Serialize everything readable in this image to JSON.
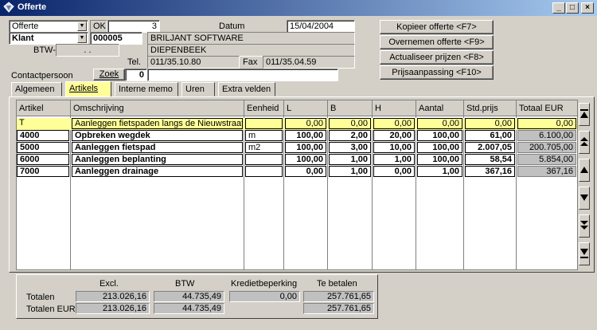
{
  "window": {
    "title": "Offerte"
  },
  "header": {
    "doc_type": "Offerte",
    "ok_label": "OK",
    "doc_number": "3",
    "date_label": "Datum",
    "date_value": "15/04/2004",
    "customer_type": "Klant",
    "customer_number": "000005",
    "customer_name": "BRILJANT SOFTWARE",
    "customer_city": "DIEPENBEEK",
    "vat_label": "BTW-nr",
    "vat_value": ".   .",
    "tel_label": "Tel.",
    "tel_value": "011/35.10.80",
    "fax_label": "Fax",
    "fax_value": "011/35.04.59",
    "contact_label": "Contactpersoon",
    "zoek_label": "Zoek",
    "contact_num": "0",
    "contact_name": ""
  },
  "actions": {
    "copy": "Kopieer offerte <F7>",
    "take_over": "Overnemen offerte <F9>",
    "update_prices": "Actualiseer prijzen <F8>",
    "adjust_prices": "Prijsaanpassing <F10>"
  },
  "tabs": [
    "Algemeen",
    "Artikels",
    "Interne memo",
    "Uren",
    "Extra velden"
  ],
  "table": {
    "columns": [
      "Artikel",
      "Omschrijving",
      "Eenheid",
      "L",
      "B",
      "H",
      "Aantal",
      "Std.prijs",
      "Totaal EUR"
    ],
    "rows": [
      [
        "T",
        "Aanleggen fietspaden langs de Nieuwstraat",
        "",
        "0,00",
        "0,00",
        "0,00",
        "0,00",
        "0,00",
        "0,00"
      ],
      [
        "4000",
        "Opbreken wegdek",
        "m",
        "100,00",
        "2,00",
        "20,00",
        "100,00",
        "61,00",
        "6.100,00"
      ],
      [
        "5000",
        "Aanleggen fietspad",
        "m2",
        "100,00",
        "3,00",
        "10,00",
        "100,00",
        "2.007,05",
        "200.705,00"
      ],
      [
        "6000",
        "Aanleggen beplanting",
        "",
        "100,00",
        "1,00",
        "1,00",
        "100,00",
        "58,54",
        "5.854,00"
      ],
      [
        "7000",
        "Aanleggen drainage",
        "",
        "0,00",
        "1,00",
        "0,00",
        "1,00",
        "367,16",
        "367,16"
      ]
    ]
  },
  "totals": {
    "col_excl": "Excl.",
    "col_btw": "BTW",
    "col_krediet": "Kredietbeperking",
    "col_te_betalen": "Te betalen",
    "row1_label": "Totalen",
    "row2_label": "Totalen EUR",
    "row1": {
      "excl": "213.026,16",
      "btw": "44.735,49",
      "krediet": "0,00",
      "te_betalen": "257.761,65"
    },
    "row2": {
      "excl": "213.026,16",
      "btw": "44.735,49",
      "te_betalen": "257.761,65"
    }
  },
  "colors": {
    "highlight": "#ffff99",
    "title_start": "#0a246a",
    "title_end": "#a6caf0"
  }
}
